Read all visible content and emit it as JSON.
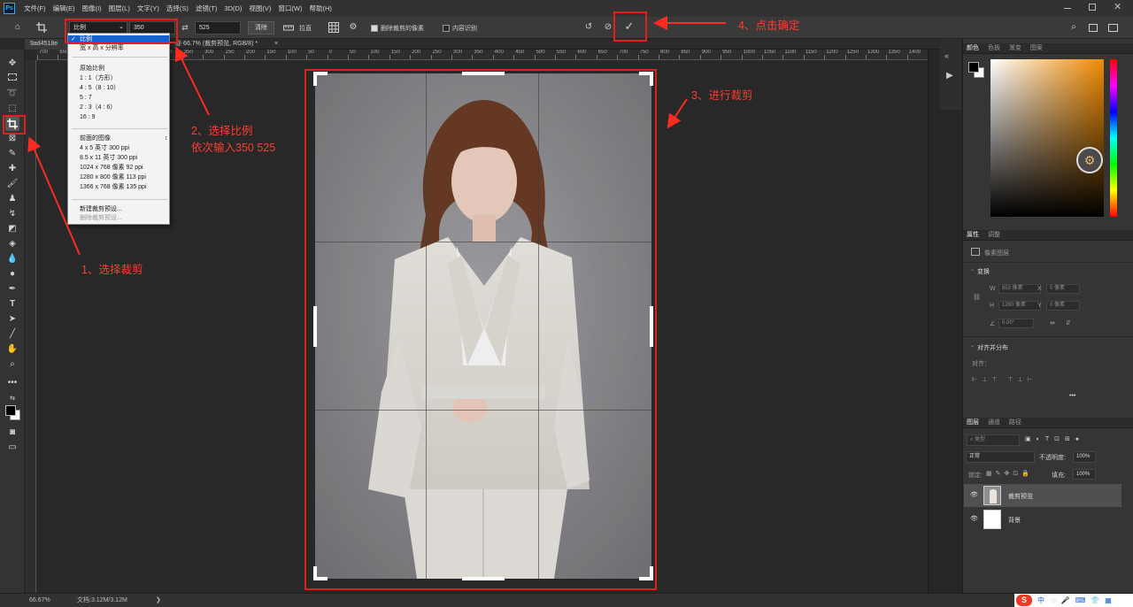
{
  "menu": [
    "文件(F)",
    "编辑(E)",
    "图像(I)",
    "图层(L)",
    "文字(Y)",
    "选择(S)",
    "滤镜(T)",
    "3D(D)",
    "视图(V)",
    "窗口(W)",
    "帮助(H)"
  ],
  "app_logo": "Ps",
  "options": {
    "ratio_select": "比例",
    "width_value": "350",
    "height_value": "525",
    "clear_label": "清除",
    "straighten_label": "拉直",
    "delete_cropped_label": "删除裁剪的像素",
    "content_aware_label": "内容识别",
    "commit_symbol": "✓"
  },
  "doc_tab": {
    "name_prefix": "9ad4518e",
    "info": "@ 66.7% (裁剪预览, RGB/8) *",
    "close": "×"
  },
  "ruler_top_labels": [
    "700",
    "650",
    "600",
    "550",
    "500",
    "450",
    "400",
    "350",
    "300",
    "250",
    "200",
    "150",
    "100",
    "50",
    "0",
    "50",
    "100",
    "150",
    "200",
    "250",
    "300",
    "350",
    "400",
    "450",
    "500",
    "550",
    "600",
    "650",
    "700",
    "750",
    "800",
    "850",
    "900",
    "950",
    "1000",
    "1050",
    "1100",
    "1150",
    "1200",
    "1250",
    "1300",
    "1350",
    "1400",
    "1450",
    "1500"
  ],
  "ratio_dropdown": {
    "selected": "比例",
    "items_top": [
      "宽 x 高 x 分辨率"
    ],
    "group1_title": "原始比例",
    "group1": [
      "1 : 1（方形）",
      "4 : 5（8 : 10）",
      "5 : 7",
      "2 : 3（4 : 6）",
      "16 : 9"
    ],
    "group2_title": "前面的图像",
    "group2": [
      "4 x 5 英寸 300 ppi",
      "8.5 x 11 英寸 300 ppi",
      "1024 x 768 像素 92 ppi",
      "1280 x 800 像素 113 ppi",
      "1366 x 768 像素 135 ppi"
    ],
    "group3": [
      "新建裁剪预设...",
      "删除裁剪预设..."
    ]
  },
  "annotations": {
    "step1": "1、选择裁剪",
    "step2_line1": "2、选择比例",
    "step2_line2": "依次输入350 525",
    "step3": "3、进行裁剪",
    "step4": "4、点击确定"
  },
  "status": {
    "zoom": "66.67%",
    "doc": "文档:3.12M/3.12M",
    "arrow": "❯"
  },
  "panels": {
    "color_tabs": [
      "颜色",
      "色板",
      "渐变",
      "图案"
    ],
    "properties_tabs": [
      "属性",
      "调整"
    ],
    "pixel_layer_label": "像素图层",
    "transform_title": "变换",
    "w_label": "W",
    "w_value": "853 像素",
    "x_label": "X",
    "x_value": "0 像素",
    "h_label": "H",
    "h_value": "1280 像素",
    "y_label": "Y",
    "y_value": "0 像素",
    "angle_value": "0.00°",
    "align_title": "对齐并分布",
    "align_label": "对齐：",
    "more": "•••",
    "layers_tabs": [
      "图层",
      "通道",
      "路径"
    ],
    "kind_label": "类型",
    "blend_mode": "正常",
    "opacity_label": "不透明度:",
    "opacity_value": "100%",
    "lock_label": "锁定:",
    "fill_label": "填充:",
    "fill_value": "100%",
    "layers": [
      "裁剪预览",
      "背景"
    ]
  },
  "taskbar_ime": "中"
}
